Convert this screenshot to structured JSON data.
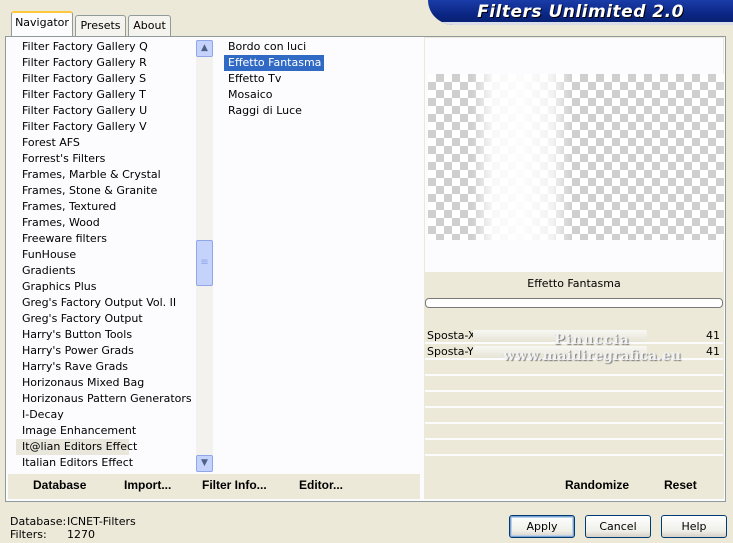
{
  "tabs": [
    {
      "label": "Navigator",
      "active": true
    },
    {
      "label": "Presets",
      "active": false
    },
    {
      "label": "About",
      "active": false
    }
  ],
  "banner": {
    "title": "Filters Unlimited 2.0"
  },
  "categories": {
    "items": [
      "Filter Factory Gallery Q",
      "Filter Factory Gallery R",
      "Filter Factory Gallery S",
      "Filter Factory Gallery T",
      "Filter Factory Gallery U",
      "Filter Factory Gallery V",
      "Forest AFS",
      "Forrest's Filters",
      "Frames, Marble & Crystal",
      "Frames, Stone & Granite",
      "Frames, Textured",
      "Frames, Wood",
      "Freeware filters",
      "FunHouse",
      "Gradients",
      "Graphics Plus",
      "Greg's Factory Output Vol. II",
      "Greg's Factory Output",
      "Harry's Button Tools",
      "Harry's Power Grads",
      "Harry's Rave Grads",
      "Horizonaus Mixed Bag",
      "Horizonaus Pattern Generators",
      "I-Decay",
      "Image Enhancement",
      "It@lian Editors Effect",
      "Italian Editors Effect"
    ],
    "selected_index": 25
  },
  "filters": {
    "items": [
      "Bordo con luci",
      "Effetto Fantasma",
      "Effetto Tv",
      "Mosaico",
      "Raggi di Luce"
    ],
    "selected_index": 1
  },
  "preview": {
    "filter_name": "Effetto Fantasma"
  },
  "params": [
    {
      "label": "Sposta-X",
      "value": "41"
    },
    {
      "label": "Sposta-Y",
      "value": "41"
    }
  ],
  "watermark": {
    "line1": "Pinuccia",
    "line2": "www.maidiregrafica.eu"
  },
  "toolbar": {
    "database": "Database",
    "import": "Import...",
    "filter_info": "Filter Info...",
    "editor": "Editor...",
    "randomize": "Randomize",
    "reset": "Reset"
  },
  "status": {
    "database_key": "Database:",
    "database_val": "ICNET-Filters",
    "filters_key": "Filters:",
    "filters_val": "1270"
  },
  "dialog": {
    "apply": "Apply",
    "cancel": "Cancel",
    "help": "Help"
  }
}
